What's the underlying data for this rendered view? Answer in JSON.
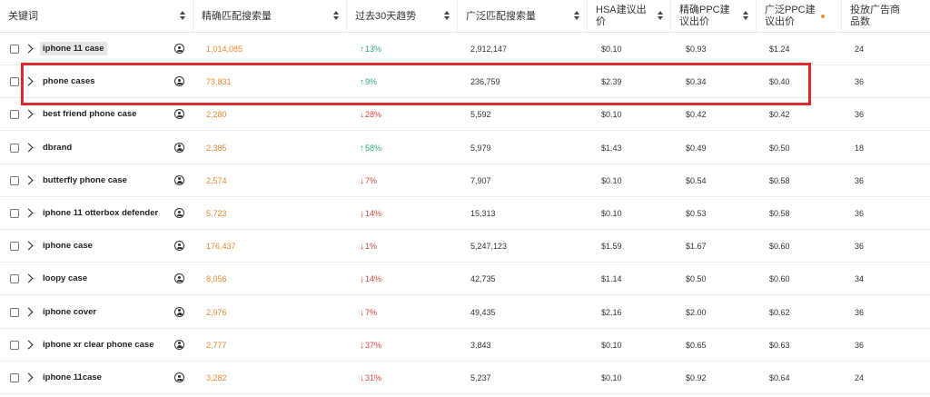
{
  "colors": {
    "exact_match": "#e8892e",
    "trend_up": "#2aa876",
    "trend_down": "#d9453b",
    "highlight_box": "#d92b2b"
  },
  "header": {
    "keyword": "关键词",
    "exact_volume": "精确匹配搜索量",
    "trend": "过去30天趋势",
    "broad_volume": "广泛匹配搜索量",
    "hsa_bid": "HSA建议出价",
    "exact_ppc": "精确PPC建议出价",
    "broad_ppc": "广泛PPC建议出价",
    "ads_count": "投放广告商品数"
  },
  "icons": {
    "sort": "sort-icon",
    "expand": "chevron-right-icon",
    "user": "user-circle-icon",
    "trend_up": "arrow-up",
    "trend_down": "arrow-down"
  },
  "rows": [
    {
      "keyword": "iphone 11 case",
      "exact": "1,014,085",
      "trend_dir": "up",
      "trend": "13%",
      "broad": "2,912,147",
      "hsa": "$0.10",
      "ppc": "$0.93",
      "bppc": "$1.24",
      "ads": "24"
    },
    {
      "keyword": "phone cases",
      "exact": "73,831",
      "trend_dir": "up",
      "trend": "9%",
      "broad": "236,759",
      "hsa": "$2.39",
      "ppc": "$0.34",
      "bppc": "$0.40",
      "ads": "36"
    },
    {
      "keyword": "best friend phone case",
      "exact": "2,280",
      "trend_dir": "down",
      "trend": "28%",
      "broad": "5,592",
      "hsa": "$0.10",
      "ppc": "$0.42",
      "bppc": "$0.42",
      "ads": "36"
    },
    {
      "keyword": "dbrand",
      "exact": "2,385",
      "trend_dir": "up",
      "trend": "58%",
      "broad": "5,979",
      "hsa": "$1.43",
      "ppc": "$0.49",
      "bppc": "$0.50",
      "ads": "18"
    },
    {
      "keyword": "butterfly phone case",
      "exact": "2,574",
      "trend_dir": "down",
      "trend": "7%",
      "broad": "7,907",
      "hsa": "$0.10",
      "ppc": "$0.54",
      "bppc": "$0.58",
      "ads": "36"
    },
    {
      "keyword": "iphone 11 otterbox defender",
      "exact": "5,723",
      "trend_dir": "down",
      "trend": "14%",
      "broad": "15,313",
      "hsa": "$0.10",
      "ppc": "$0.53",
      "bppc": "$0.58",
      "ads": "36"
    },
    {
      "keyword": "iphone case",
      "exact": "176,437",
      "trend_dir": "down",
      "trend": "1%",
      "broad": "5,247,123",
      "hsa": "$1.59",
      "ppc": "$1.67",
      "bppc": "$0.60",
      "ads": "36"
    },
    {
      "keyword": "loopy case",
      "exact": "8,056",
      "trend_dir": "down",
      "trend": "14%",
      "broad": "42,735",
      "hsa": "$1.14",
      "ppc": "$0.50",
      "bppc": "$0.60",
      "ads": "34"
    },
    {
      "keyword": "iphone cover",
      "exact": "2,976",
      "trend_dir": "down",
      "trend": "7%",
      "broad": "49,435",
      "hsa": "$2.16",
      "ppc": "$2.00",
      "bppc": "$0.62",
      "ads": "36"
    },
    {
      "keyword": "iphone xr clear phone case",
      "exact": "2,777",
      "trend_dir": "down",
      "trend": "37%",
      "broad": "3,843",
      "hsa": "$0.10",
      "ppc": "$0.65",
      "bppc": "$0.63",
      "ads": "36"
    },
    {
      "keyword": "iphone 11case",
      "exact": "3,282",
      "trend_dir": "down",
      "trend": "31%",
      "broad": "5,237",
      "hsa": "$0.10",
      "ppc": "$0.92",
      "bppc": "$0.64",
      "ads": "24"
    }
  ]
}
